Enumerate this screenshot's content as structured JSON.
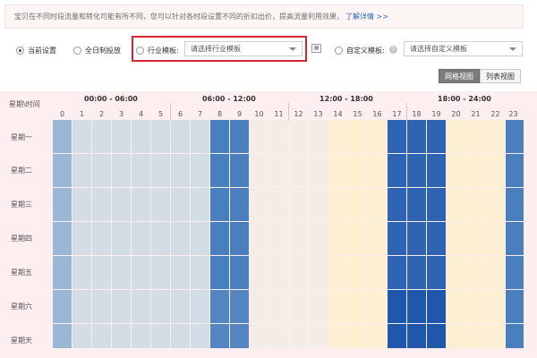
{
  "notice": {
    "text": "宝贝在不同时段流量和转化可能有所不同，您可以针对各时段设置不同的折扣出价，提高流量利用效果，",
    "link": "了解详情 >>"
  },
  "options": {
    "current": "当前设置",
    "allday": "全日制投放",
    "industry": "行业模板:",
    "industry_select": "请选择行业模板",
    "custom": "自定义模板:",
    "custom_select": "请选择自定义模板",
    "help": "?"
  },
  "view_buttons": {
    "grid": "网格视图",
    "list": "列表视图"
  },
  "grid": {
    "corner": "星期\\时间",
    "ranges": [
      "00:00 - 06:00",
      "06:00 - 12:00",
      "12:00 - 18:00",
      "18:00 - 24:00"
    ],
    "hours": [
      "0",
      "1",
      "2",
      "3",
      "4",
      "5",
      "6",
      "7",
      "8",
      "9",
      "10",
      "11",
      "12",
      "13",
      "14",
      "15",
      "16",
      "17",
      "18",
      "19",
      "20",
      "21",
      "22",
      "23"
    ],
    "days": [
      "星期一",
      "星期二",
      "星期三",
      "星期四",
      "星期五",
      "星期六",
      "星期天"
    ]
  },
  "colors": {
    "c0": "#9ab8d5",
    "c1": "#d4dde6",
    "c2": "#4a7fbf",
    "c3": "#f4ece6",
    "c4": "#fdf0d2",
    "c5": "#2f64b3",
    "c6": "#1f57ad",
    "c7": "#5586c2"
  },
  "hour_levels": [
    [
      0,
      1,
      1,
      1,
      1,
      1,
      1,
      1,
      2,
      2,
      3,
      3,
      3,
      3,
      4,
      4,
      4,
      5,
      5,
      5,
      4,
      4,
      4,
      2
    ],
    [
      0,
      1,
      1,
      1,
      1,
      1,
      1,
      1,
      2,
      2,
      3,
      3,
      3,
      3,
      4,
      4,
      4,
      5,
      5,
      5,
      4,
      4,
      4,
      2
    ],
    [
      0,
      1,
      1,
      1,
      1,
      1,
      1,
      1,
      2,
      2,
      3,
      3,
      3,
      3,
      4,
      4,
      4,
      5,
      5,
      5,
      4,
      4,
      4,
      2
    ],
    [
      0,
      1,
      1,
      1,
      1,
      1,
      1,
      1,
      2,
      2,
      3,
      3,
      3,
      3,
      4,
      4,
      4,
      5,
      5,
      5,
      4,
      4,
      4,
      2
    ],
    [
      0,
      1,
      1,
      1,
      1,
      1,
      1,
      1,
      2,
      2,
      3,
      3,
      3,
      3,
      4,
      4,
      4,
      5,
      5,
      5,
      4,
      4,
      4,
      2
    ],
    [
      0,
      1,
      1,
      1,
      1,
      1,
      1,
      1,
      7,
      7,
      3,
      3,
      3,
      3,
      4,
      4,
      4,
      6,
      6,
      6,
      4,
      4,
      4,
      2
    ],
    [
      0,
      1,
      1,
      1,
      1,
      1,
      1,
      1,
      7,
      7,
      3,
      3,
      3,
      3,
      4,
      4,
      4,
      6,
      6,
      6,
      4,
      4,
      4,
      2
    ]
  ]
}
